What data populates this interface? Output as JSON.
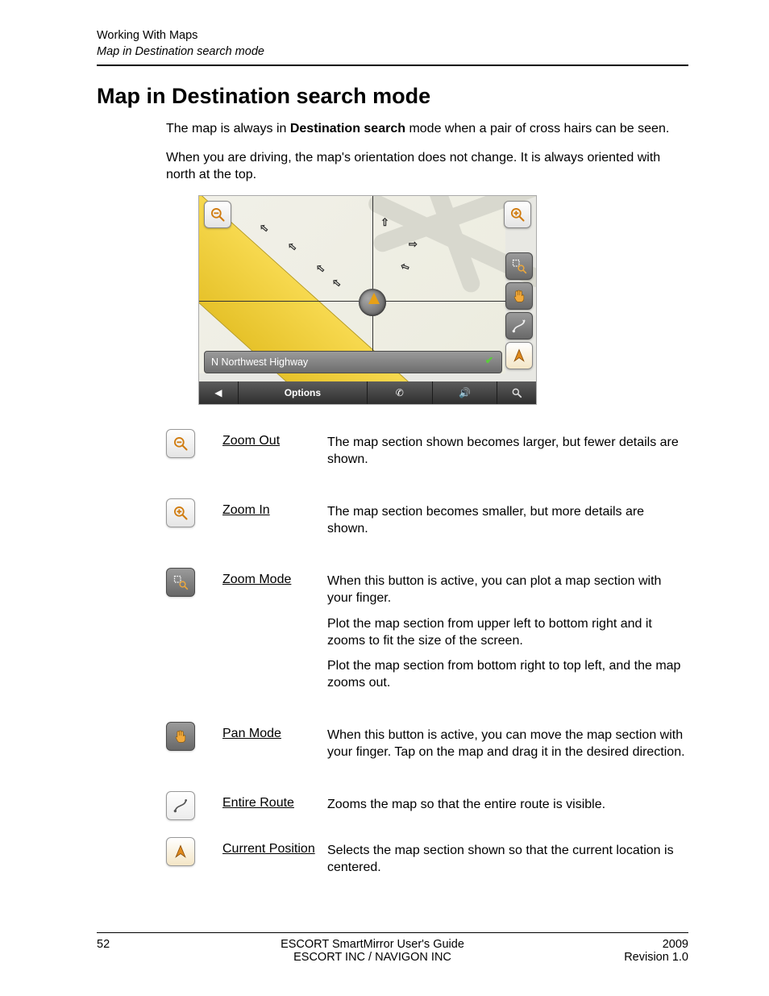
{
  "header": {
    "chapter": "Working With Maps",
    "section_ref": "Map in Destination search mode"
  },
  "title": "Map in Destination search mode",
  "intro": {
    "p1_a": "The map is always in ",
    "p1_bold": "Destination search",
    "p1_b": " mode when a pair of cross hairs can be seen.",
    "p2": "When you are driving, the map's orientation does not change. It is always oriented with north at the top."
  },
  "screenshot": {
    "street_name": "N Northwest Highway",
    "options_label": "Options"
  },
  "features": {
    "zoom_out": {
      "label": "Zoom Out",
      "desc1": "The map section shown becomes larger, but fewer details are shown."
    },
    "zoom_in": {
      "label": "Zoom In",
      "desc1": "The map section becomes smaller, but more details are shown."
    },
    "zoom_mode": {
      "label": "Zoom Mode",
      "desc1": "When this button is active, you can plot a map section with your finger.",
      "desc2": "Plot the map section from upper left to bottom right and it zooms to fit the size of the screen.",
      "desc3": "Plot the map section from bottom right to top left, and the map zooms out."
    },
    "pan_mode": {
      "label": "Pan Mode",
      "desc1": "When this button is active, you can move the map section with your finger. Tap on the map and drag it in the desired direction."
    },
    "entire_route": {
      "label": "Entire Route",
      "desc1": "Zooms the map so that the entire route is visible."
    },
    "current_position": {
      "label": "Current Position",
      "desc1": "Selects the map section shown so that the current location is centered."
    }
  },
  "footer": {
    "page_number": "52",
    "center1": "ESCORT SmartMirror User's Guide",
    "center2": "ESCORT INC / NAVIGON INC",
    "right1": "2009",
    "right2": "Revision 1.0"
  }
}
